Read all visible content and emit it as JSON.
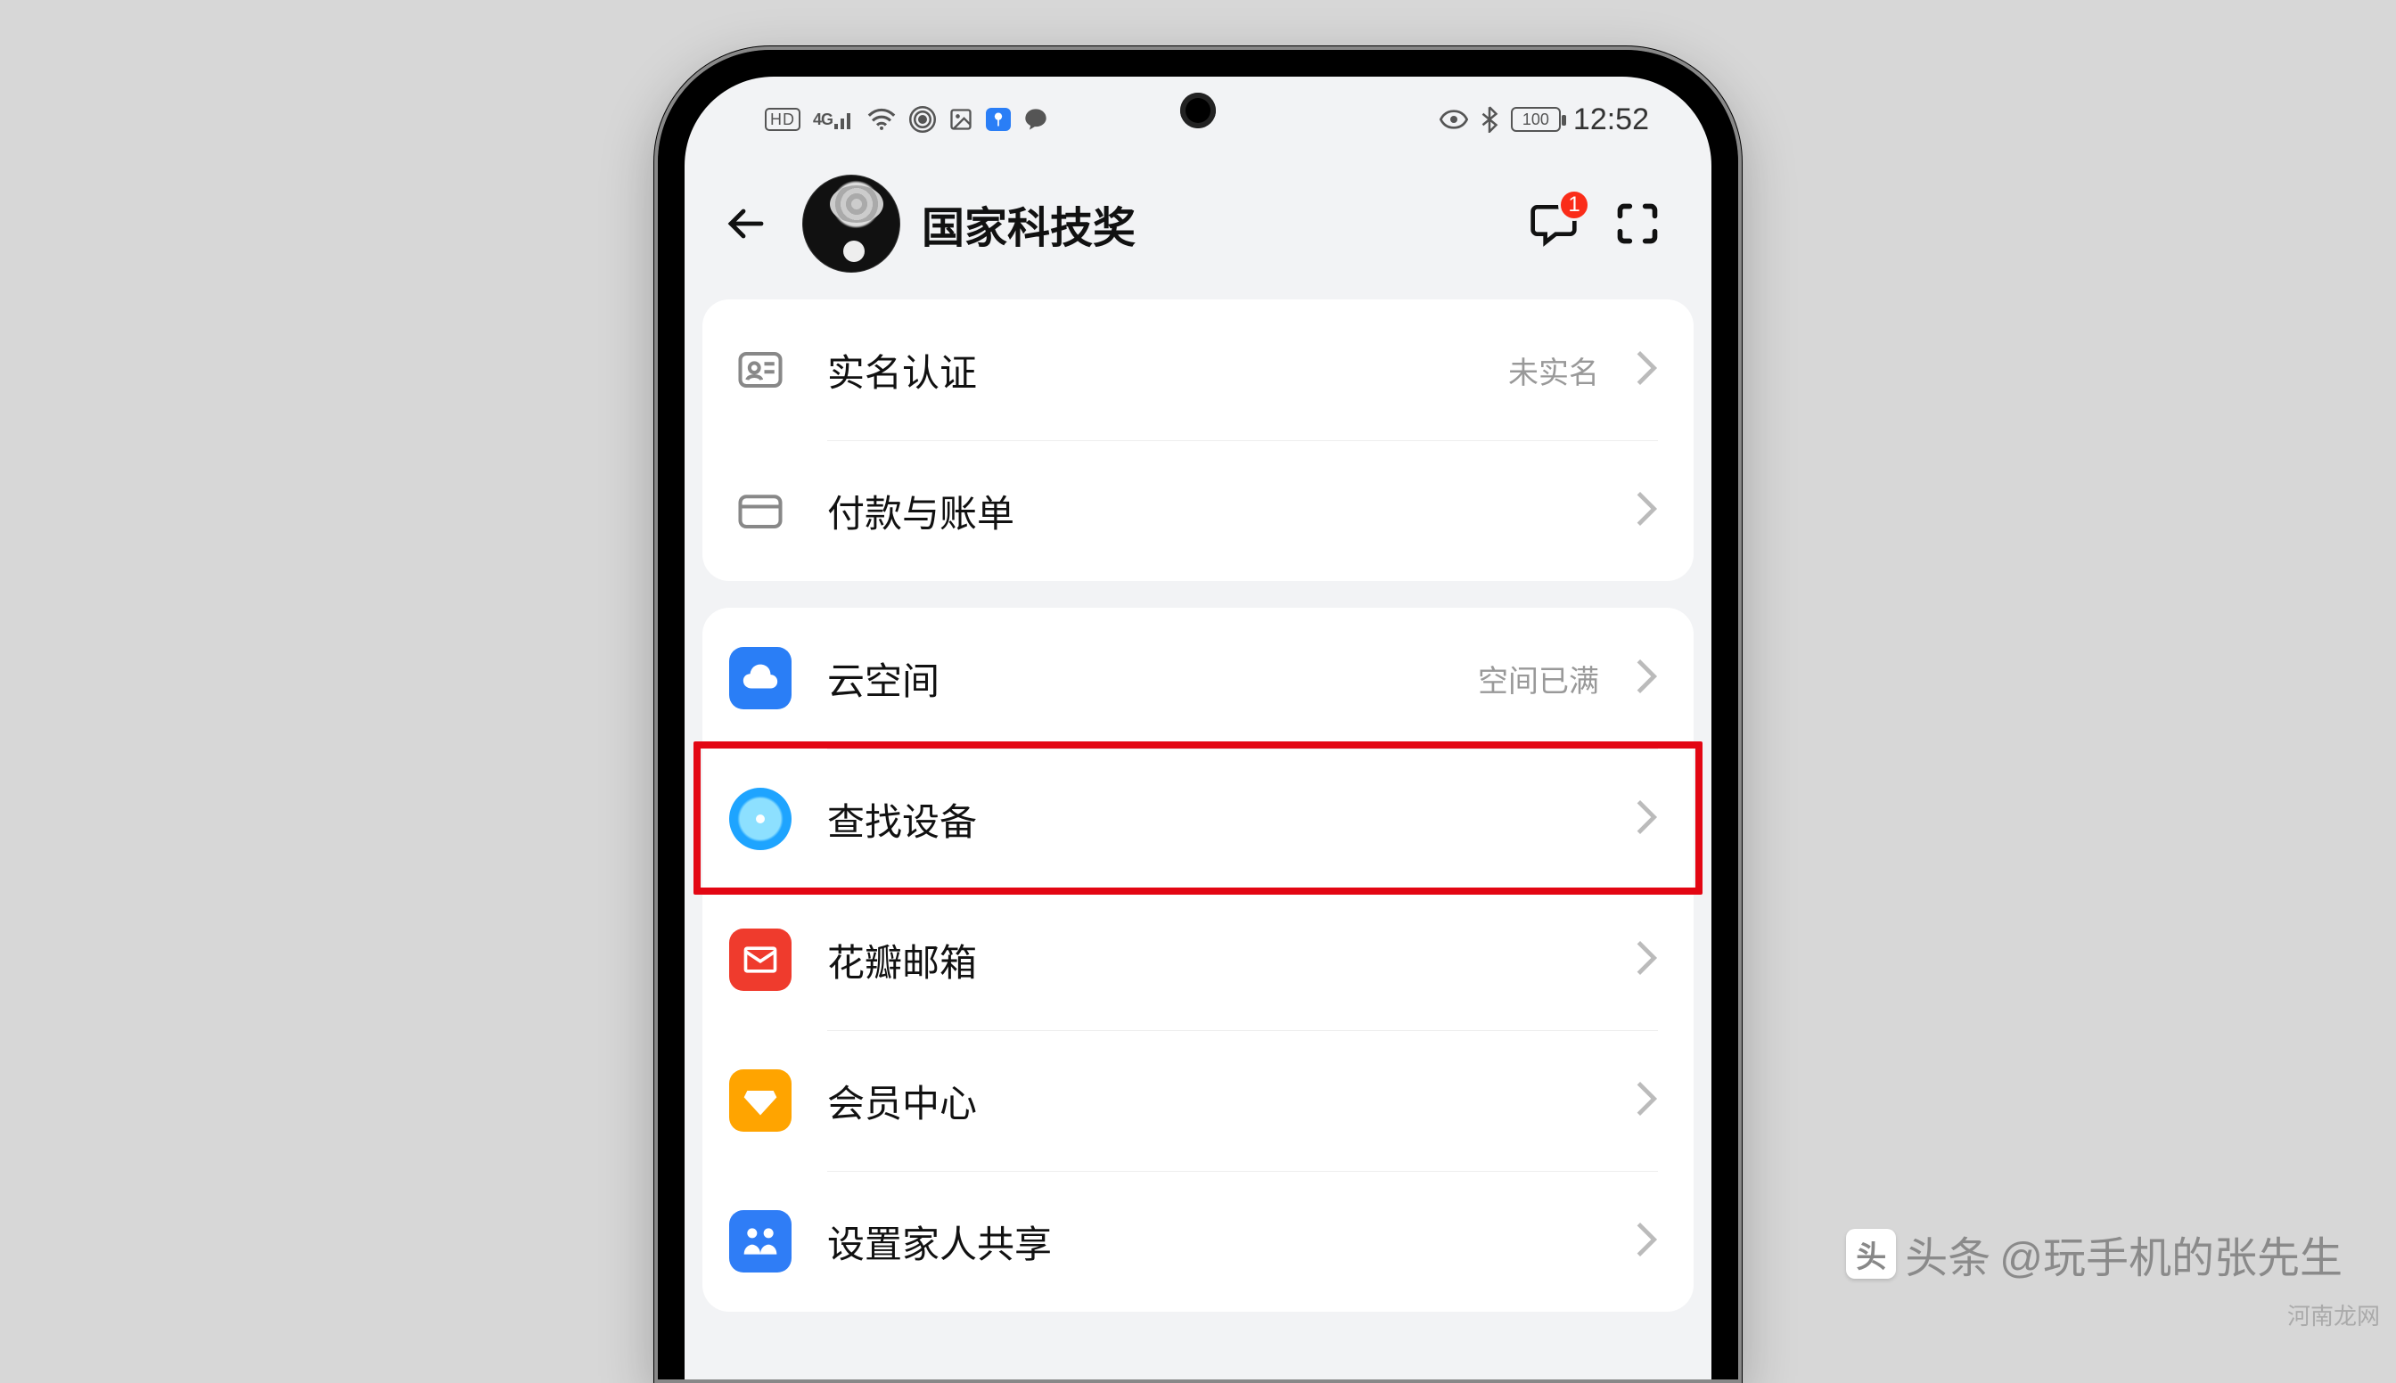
{
  "statusbar": {
    "hd": "HD",
    "net": "4G",
    "battery": "100",
    "time": "12:52"
  },
  "header": {
    "title": "国家科技奖",
    "badge": "1"
  },
  "group1": [
    {
      "label": "实名认证",
      "value": "未实名",
      "icon": "id-card-icon"
    },
    {
      "label": "付款与账单",
      "value": "",
      "icon": "wallet-icon"
    }
  ],
  "group2": [
    {
      "label": "云空间",
      "value": "空间已满",
      "icon": "cloud-icon",
      "bg": "ic-cloud"
    },
    {
      "label": "查找设备",
      "value": "",
      "icon": "radar-icon",
      "bg": "ic-find",
      "highlight": true
    },
    {
      "label": "花瓣邮箱",
      "value": "",
      "icon": "mail-icon",
      "bg": "ic-mail"
    },
    {
      "label": "会员中心",
      "value": "",
      "icon": "diamond-icon",
      "bg": "ic-member"
    },
    {
      "label": "设置家人共享",
      "value": "",
      "icon": "family-icon",
      "bg": "ic-family"
    }
  ],
  "watermark": {
    "toutiao_prefix": "头条",
    "toutiao_handle": "@玩手机的张先生",
    "site": "河南龙网"
  }
}
